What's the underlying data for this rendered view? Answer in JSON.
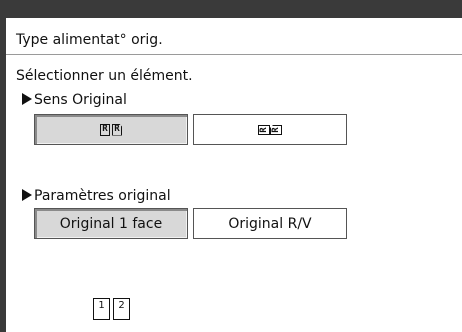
{
  "header": {
    "title": "Type alimentat° orig."
  },
  "instruction": "Sélectionner un élément.",
  "sections": {
    "orientation": {
      "label": "Sens Original",
      "options": [
        {
          "glyph_a": "R",
          "glyph_b": "R",
          "icon": "portrait-original-icon",
          "selected": true
        },
        {
          "glyph_a": "R",
          "glyph_b": "R",
          "icon": "landscape-original-icon",
          "selected": false
        }
      ]
    },
    "original_settings": {
      "label": "Paramètres original",
      "options": [
        {
          "label": "Original 1 face",
          "selected": true
        },
        {
          "label": "Original R/V",
          "selected": false
        }
      ]
    }
  },
  "preview": {
    "page1": "1",
    "page2": "2"
  },
  "colors": {
    "frame": "#3a3a3a",
    "selected_button": "#d8d8d8",
    "border": "#555555"
  }
}
